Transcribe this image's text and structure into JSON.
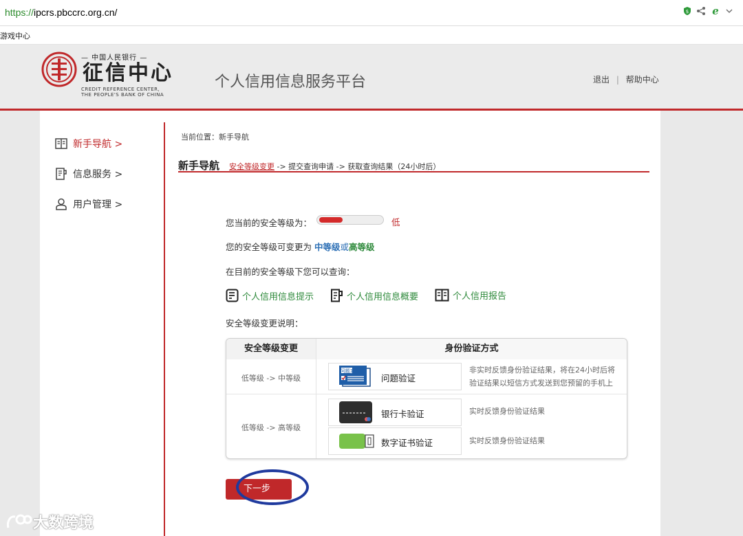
{
  "browser": {
    "url_scheme": "https://",
    "url_host": "ipcrs.pbccrc.org.cn/",
    "favorites": [
      "游戏中心"
    ]
  },
  "header": {
    "logo_top": "— 中国人民银行 —",
    "logo_cn": "征信中心",
    "logo_en1": "CREDIT REFERENCE CENTER,",
    "logo_en2": "THE PEOPLE'S BANK OF CHINA",
    "platform_title": "个人信用信息服务平台",
    "logout": "退出",
    "sep": "|",
    "help": "帮助中心"
  },
  "sidebar": {
    "items": [
      {
        "label": "新手导航 >",
        "icon": "book-icon"
      },
      {
        "label": "信息服务 >",
        "icon": "document-icon"
      },
      {
        "label": "用户管理 >",
        "icon": "user-icon"
      }
    ]
  },
  "main": {
    "breadcrumb": "当前位置：新手导航",
    "nav_title": "新手导航",
    "steps": {
      "s1": "安全等级变更",
      "rest": " -> 提交查询申请 -> 获取查询结果（24小时后）"
    },
    "current_level_label": "您当前的安全等级为：",
    "current_level_value": "低",
    "current_level_fill": 0.38,
    "change_prefix": "您的安全等级可变更为 ",
    "change_mid": "中等级",
    "change_or": "或",
    "change_high": "高等级",
    "can_query": "在目前的安全等级下您可以查询：",
    "query_links": [
      "个人信用信息提示",
      "个人信用信息概要",
      "个人信用报告"
    ],
    "explain_label": "安全等级变更说明：",
    "table": {
      "col1": "安全等级变更",
      "col2": "身份验证方式",
      "row1_level": "低等级 -> 中等级",
      "row1_method": "问题验证",
      "row1_icon_text": "问题1",
      "row1_desc1": "非实时反馈身份验证结果，将在24小时后将",
      "row1_desc2": "验证结果以短信方式发送到您预留的手机上",
      "row2_level": "低等级 -> 高等级",
      "row2_method": "银行卡验证",
      "row2_desc": "实时反馈身份验证结果",
      "row3_method": "数字证书验证",
      "row3_desc": "实时反馈身份验证结果"
    },
    "next_button": "下一步"
  },
  "watermark": "大数跨境",
  "colors": {
    "brand_red": "#c0282a",
    "green": "#2f8a3c",
    "blue": "#2c6fb5",
    "annotation_circle": "#1f3a9e"
  }
}
